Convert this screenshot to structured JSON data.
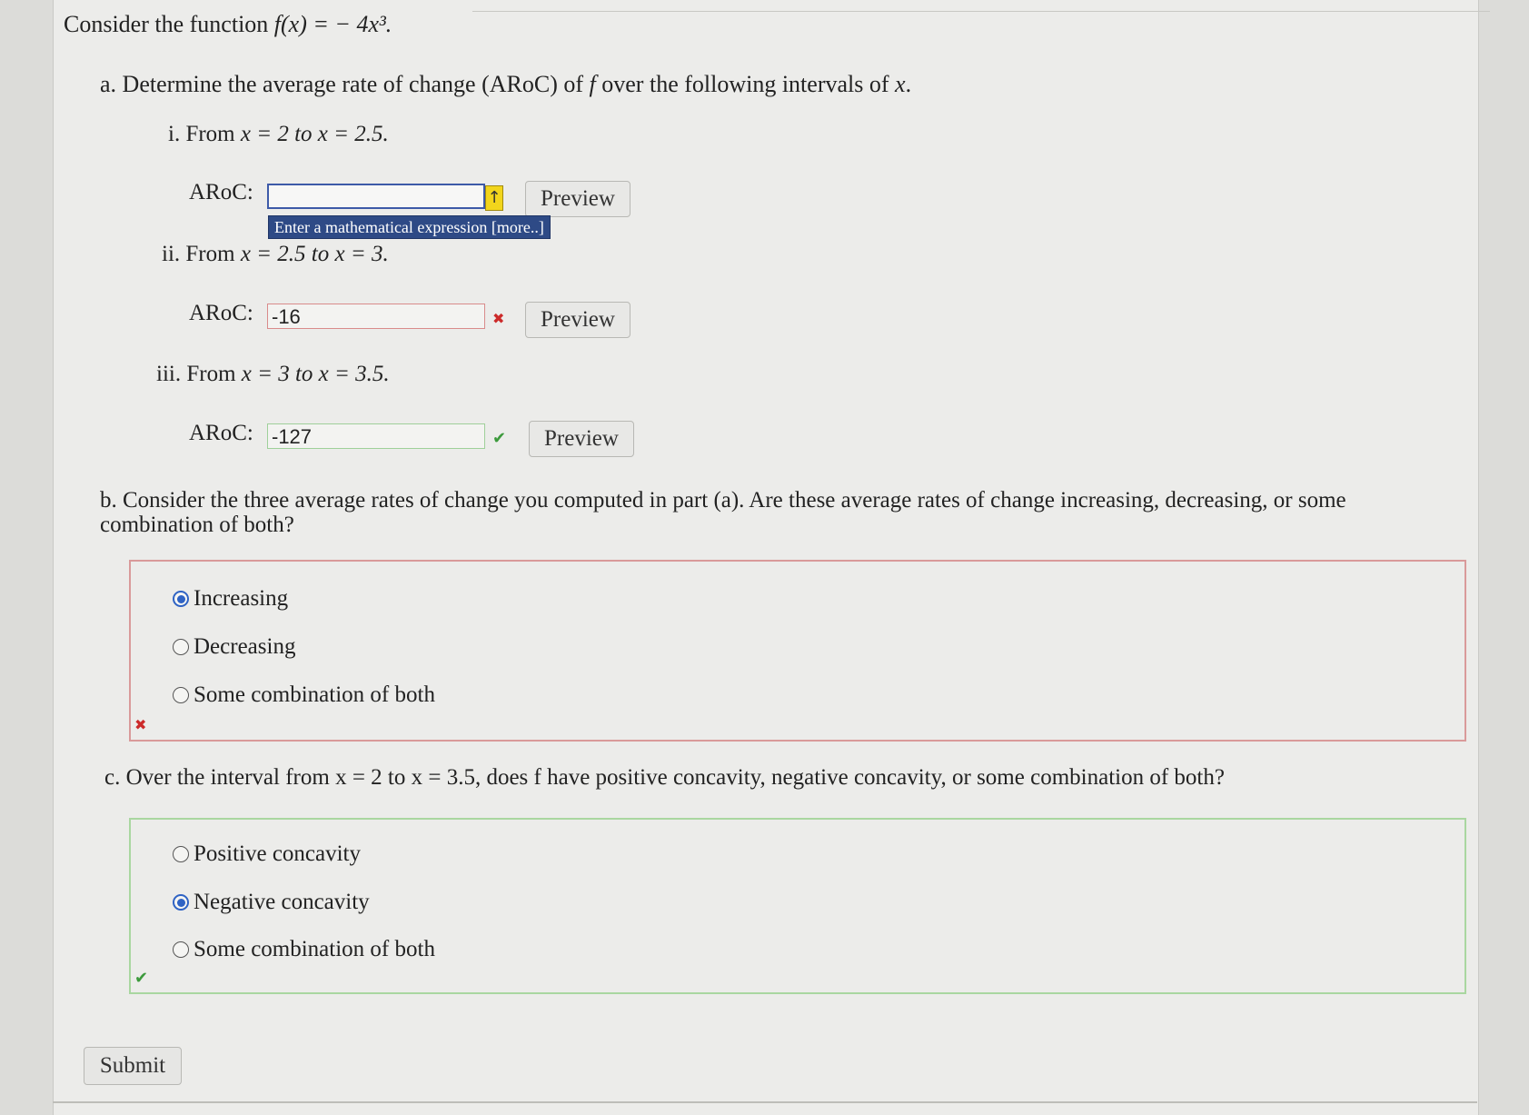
{
  "intro": {
    "prefix": "Consider the function ",
    "func": "f(x) = − 4x³."
  },
  "part_a": {
    "label": "a. Determine the average rate of change (ARoC) of ",
    "f": "f",
    "suffix": " over the following intervals of ",
    "x": "x",
    "end": "."
  },
  "items": [
    {
      "label": "i. From ",
      "math": "x = 2 to x = 2.5.",
      "aroc_label": "ARoC:",
      "value": "",
      "status": "active",
      "preview": "Preview"
    },
    {
      "label": "ii. From ",
      "math": "x = 2.5 to x = 3.",
      "aroc_label": "ARoC:",
      "value": "-16",
      "status": "wrong",
      "preview": "Preview"
    },
    {
      "label": "iii. From ",
      "math": "x = 3 to x = 3.5.",
      "aroc_label": "ARoC:",
      "value": "-127",
      "status": "correct",
      "preview": "Preview"
    }
  ],
  "hint": "Enter a mathematical expression [more..]",
  "up_arrow": "↑",
  "part_b": {
    "question": "b. Consider the three average rates of change you computed in part (a). Are these average rates of change increasing, decreasing, or some combination of both?",
    "options": [
      "Increasing",
      "Decreasing",
      "Some combination of both"
    ],
    "selected": 0,
    "status": "wrong"
  },
  "part_c": {
    "question": "c. Over the interval from x = 2 to x = 3.5, does f have positive concavity, negative concavity, or some combination of both?",
    "options": [
      "Positive concavity",
      "Negative concavity",
      "Some combination of both"
    ],
    "selected": 1,
    "status": "correct"
  },
  "marks": {
    "wrong": "✖",
    "correct": "✔"
  },
  "submit_label": "Submit",
  "colors": {
    "wrong": "#cc2a2a",
    "correct": "#3c9a3c",
    "selected_radio": "#2f63c4",
    "hint_bg": "#2e4a86",
    "arrow_btn": "#f2d51c"
  }
}
